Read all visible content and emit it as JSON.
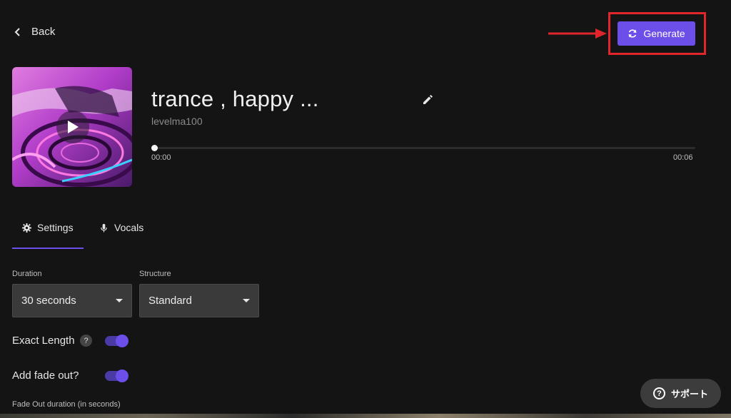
{
  "nav": {
    "back_label": "Back"
  },
  "actions": {
    "generate_label": "Generate"
  },
  "track": {
    "title": "trance , happy ...",
    "author": "levelma100",
    "time_start": "00:00",
    "time_end": "00:06",
    "progress": 0
  },
  "tabs": [
    {
      "label": "Settings",
      "icon": "gear-icon",
      "active": true
    },
    {
      "label": "Vocals",
      "icon": "microphone-icon",
      "active": false
    }
  ],
  "settings": {
    "duration_label": "Duration",
    "duration_value": "30 seconds",
    "structure_label": "Structure",
    "structure_value": "Standard",
    "exact_length_label": "Exact Length",
    "exact_length_help": "?",
    "exact_length_on": true,
    "fade_out_label": "Add fade out?",
    "fade_out_on": true,
    "fade_out_duration_label": "Fade Out duration (in seconds)"
  },
  "support": {
    "label": "サポート",
    "help_glyph": "?"
  },
  "colors": {
    "accent": "#6c4ee8",
    "highlight": "#e0262b",
    "background": "#141414"
  }
}
